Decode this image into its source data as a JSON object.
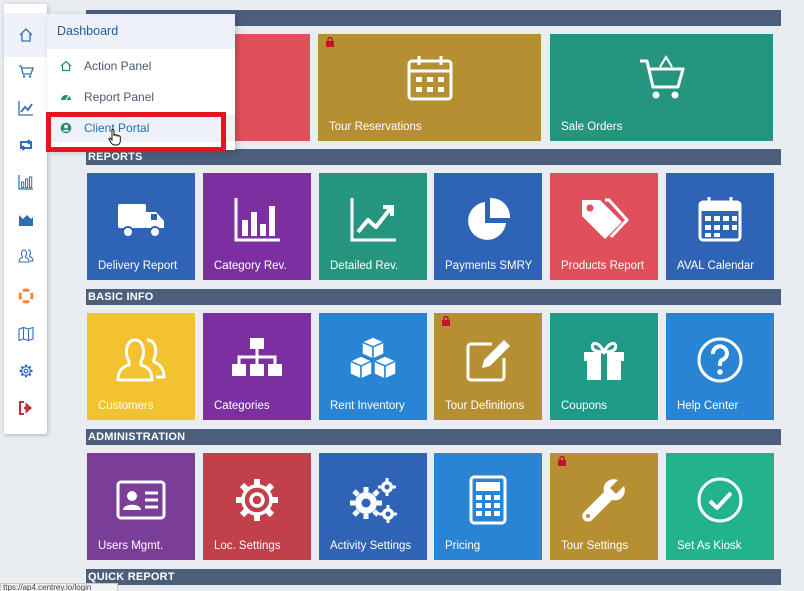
{
  "colors": {
    "section_bar": "#4b5f7d",
    "red": "#e0505b",
    "gold": "#b68f32",
    "teal": "#26957f",
    "blue": "#2e63b5",
    "purple": "#7b2fa0",
    "green_teal": "#1e9a86",
    "yellow": "#f2c231",
    "sky": "#2a84d4",
    "plum": "#7a3e99",
    "crimson": "#c1404c",
    "emerald": "#22b28c",
    "highlight": "#e8141d"
  },
  "sections": {
    "reports": "REPORTS",
    "basic_info": "BASIC INFO",
    "administration": "ADMINISTRATION",
    "quick_report": "QUICK REPORT"
  },
  "tiles": {
    "row1": [
      {
        "label": "",
        "icon": "blank"
      },
      {
        "label": "Tour Reservations",
        "icon": "calendar-icon",
        "locked": true
      },
      {
        "label": "Sale Orders",
        "icon": "cart-icon"
      }
    ],
    "reports": [
      {
        "label": "Delivery Report",
        "icon": "truck-icon"
      },
      {
        "label": "Category Rev.",
        "icon": "bar-chart-icon"
      },
      {
        "label": "Detailed Rev.",
        "icon": "line-chart-icon"
      },
      {
        "label": "Payments SMRY",
        "icon": "pie-chart-icon"
      },
      {
        "label": "Products Report",
        "icon": "tags-icon"
      },
      {
        "label": "AVAL Calendar",
        "icon": "calendar-icon"
      }
    ],
    "basic_info": [
      {
        "label": "Customers",
        "icon": "users-icon"
      },
      {
        "label": "Categories",
        "icon": "sitemap-icon"
      },
      {
        "label": "Rent Inventory",
        "icon": "cubes-icon"
      },
      {
        "label": "Tour Definitions",
        "icon": "edit-icon",
        "locked": true
      },
      {
        "label": "Coupons",
        "icon": "gift-icon"
      },
      {
        "label": "Help Center",
        "icon": "question-icon"
      }
    ],
    "administration": [
      {
        "label": "Users Mgmt.",
        "icon": "id-card-icon"
      },
      {
        "label": "Loc. Settings",
        "icon": "gear-icon"
      },
      {
        "label": "Activity Settings",
        "icon": "gears-icon"
      },
      {
        "label": "Pricing",
        "icon": "calculator-icon"
      },
      {
        "label": "Tour Settings",
        "icon": "wrench-icon",
        "locked": true
      },
      {
        "label": "Set As Kiosk",
        "icon": "check-circle-icon"
      }
    ]
  },
  "dropdown": {
    "header": "Dashboard",
    "items": [
      {
        "label": "Action Panel",
        "icon": "home-icon"
      },
      {
        "label": "Report Panel",
        "icon": "gauge-icon"
      },
      {
        "label": "Client Portal",
        "icon": "user-circle-icon"
      }
    ]
  },
  "rail": [
    "home-icon",
    "cart-icon",
    "chart-line-icon",
    "retweet-icon",
    "bar-chart-icon",
    "area-chart-icon",
    "users-icon",
    "life-ring-icon",
    "map-icon",
    "gear-icon",
    "sign-out-icon"
  ],
  "statusbar": "ttps://ap4.centrey.io/login"
}
